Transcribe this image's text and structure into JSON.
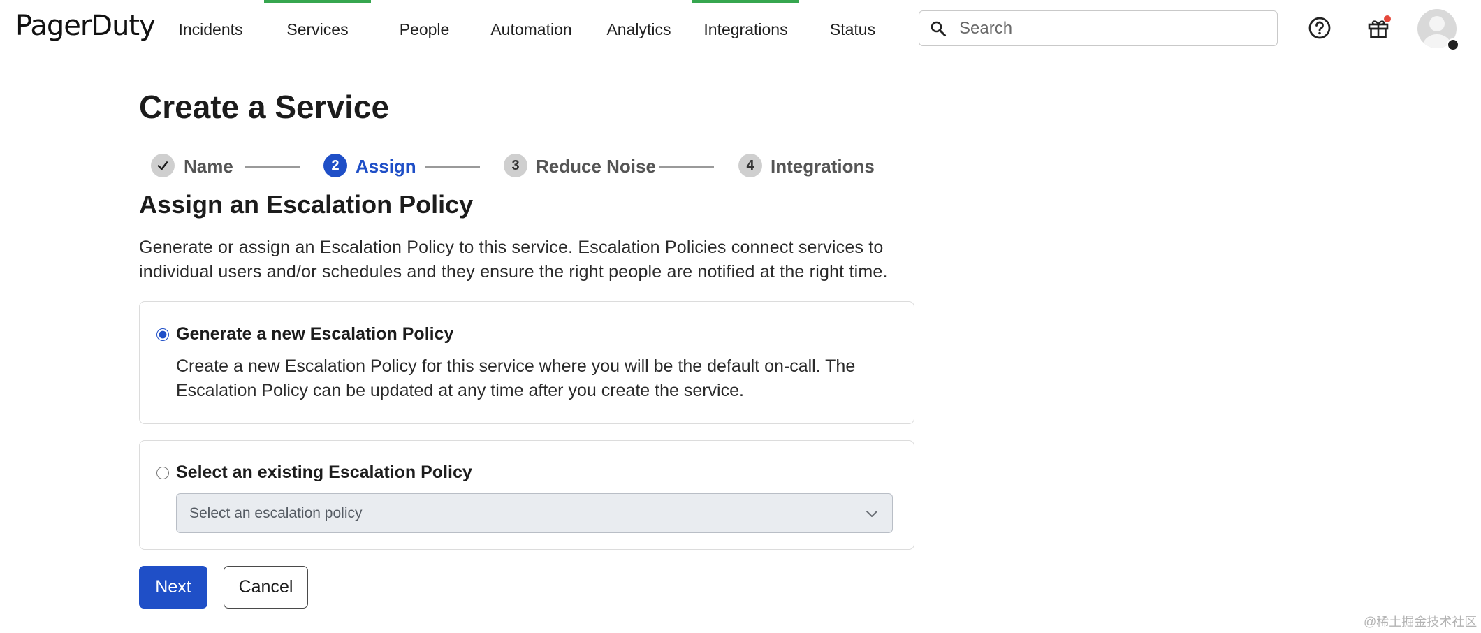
{
  "app": {
    "logo": "PagerDuty"
  },
  "nav": {
    "items": [
      {
        "label": "Incidents",
        "active": false
      },
      {
        "label": "Services",
        "active": true
      },
      {
        "label": "People",
        "active": false
      },
      {
        "label": "Automation",
        "active": false
      },
      {
        "label": "Analytics",
        "active": false
      },
      {
        "label": "Integrations",
        "active": true
      },
      {
        "label": "Status",
        "active": false
      }
    ],
    "search_placeholder": "Search",
    "icons": [
      "search-icon",
      "help-icon",
      "gift-icon",
      "avatar"
    ]
  },
  "page": {
    "title": "Create a Service",
    "steps": [
      {
        "marker": "✓",
        "label": "Name",
        "state": "done"
      },
      {
        "marker": "2",
        "label": "Assign",
        "state": "current"
      },
      {
        "marker": "3",
        "label": "Reduce Noise",
        "state": "todo"
      },
      {
        "marker": "4",
        "label": "Integrations",
        "state": "todo"
      }
    ],
    "section_title": "Assign an Escalation Policy",
    "intro": "Generate or assign an Escalation Policy to this service. Escalation Policies connect services to individual users and/or schedules and they ensure the right people are notified at the right time.",
    "options": [
      {
        "label": "Generate a new Escalation Policy",
        "description": "Create a new Escalation Policy for this service where you will be the default on-call. The Escalation Policy can be updated at any time after you create the service.",
        "selected": true
      },
      {
        "label": "Select an existing Escalation Policy",
        "select_placeholder": "Select an escalation policy",
        "selected": false
      }
    ],
    "buttons": {
      "next": "Next",
      "cancel": "Cancel"
    }
  },
  "watermark": "@稀土掘金技术社区",
  "colors": {
    "primary": "#1f4fc7",
    "nav_active": "#36a64f",
    "notification": "#e5483b"
  }
}
